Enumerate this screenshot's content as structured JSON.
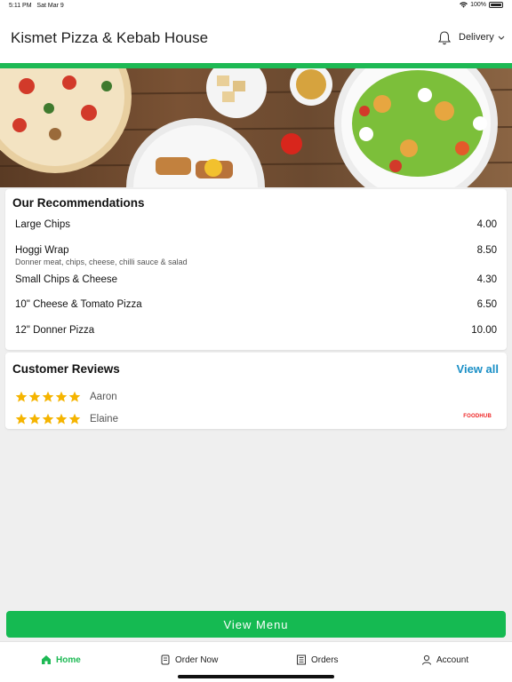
{
  "status": {
    "time": "5:11 PM",
    "date": "Sat Mar 9",
    "battery": "100%"
  },
  "header": {
    "title": "Kismet Pizza & Kebab House",
    "delivery_label": "Delivery"
  },
  "colors": {
    "accent": "#1db954",
    "button": "#15ba52",
    "link": "#1a8fc6",
    "star": "#f5b400",
    "foodhub": "#ee2222"
  },
  "recommendations": {
    "heading": "Our Recommendations",
    "items": [
      {
        "name": "Large Chips",
        "price": "4.00",
        "description": ""
      },
      {
        "name": "Hoggi Wrap",
        "price": "8.50",
        "description": "Donner meat, chips, cheese, chilli sauce & salad"
      },
      {
        "name": "Small Chips & Cheese",
        "price": "4.30",
        "description": ""
      },
      {
        "name": "10\" Cheese & Tomato Pizza",
        "price": "6.50",
        "description": ""
      },
      {
        "name": "12\" Donner Pizza",
        "price": "10.00",
        "description": ""
      }
    ]
  },
  "reviews": {
    "heading": "Customer Reviews",
    "view_all": "View all",
    "brand": "FOODHUB",
    "items": [
      {
        "name": "Aaron",
        "rating": 5
      },
      {
        "name": "Elaine",
        "rating": 5
      }
    ]
  },
  "view_menu_label": "View Menu",
  "tabs": [
    {
      "label": "Home",
      "icon": "home-icon",
      "active": true
    },
    {
      "label": "Order Now",
      "icon": "order-icon",
      "active": false
    },
    {
      "label": "Orders",
      "icon": "orders-icon",
      "active": false
    },
    {
      "label": "Account",
      "icon": "account-icon",
      "active": false
    }
  ]
}
